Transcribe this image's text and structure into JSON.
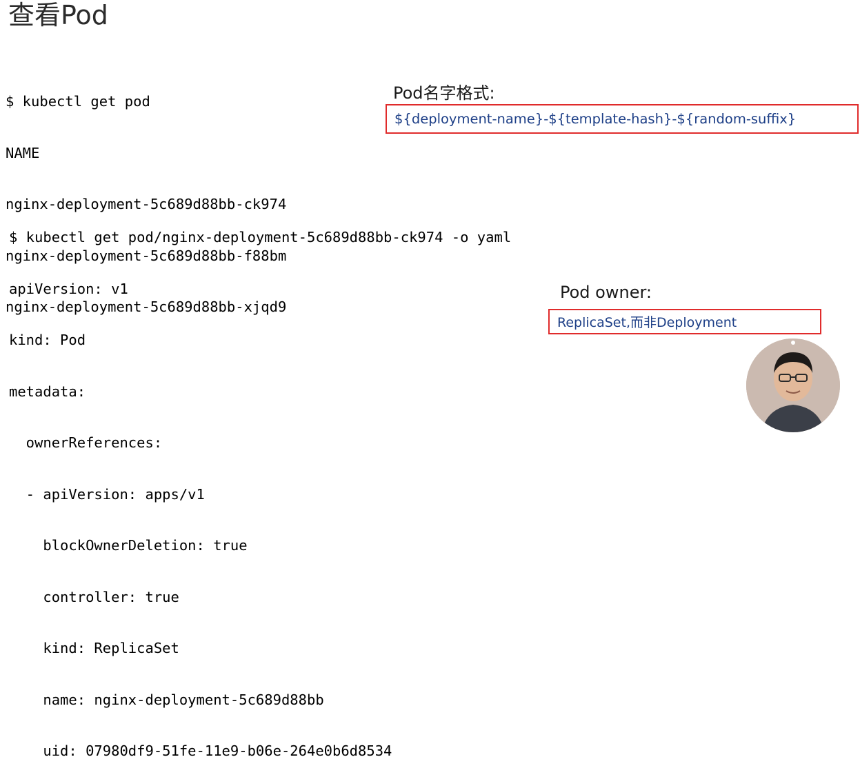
{
  "slide": {
    "title": "查看Pod"
  },
  "code_block_1": {
    "lines": [
      "$ kubectl get pod",
      "NAME",
      "nginx-deployment-5c689d88bb-ck974",
      "nginx-deployment-5c689d88bb-f88bm",
      "nginx-deployment-5c689d88bb-xjqd9"
    ]
  },
  "code_block_2": {
    "lines": [
      "$ kubectl get pod/nginx-deployment-5c689d88bb-ck974 -o yaml",
      "apiVersion: v1",
      "kind: Pod",
      "metadata:",
      "  ownerReferences:",
      "  - apiVersion: apps/v1",
      "    blockOwnerDeletion: true",
      "    controller: true",
      "    kind: ReplicaSet",
      "    name: nginx-deployment-5c689d88bb",
      "    uid: 07980df9-51fe-11e9-b06e-264e0b6d8534"
    ]
  },
  "annotations": {
    "pod_name_format": {
      "label": "Pod名字格式:",
      "value": "${deployment-name}-${template-hash}-${random-suffix}"
    },
    "pod_owner": {
      "label": "Pod owner:",
      "value": "ReplicaSet,而非Deployment"
    }
  },
  "colors": {
    "highlight_border": "#e02b2b",
    "highlight_text": "#1d3f87",
    "title_text": "#2b2b2b"
  }
}
